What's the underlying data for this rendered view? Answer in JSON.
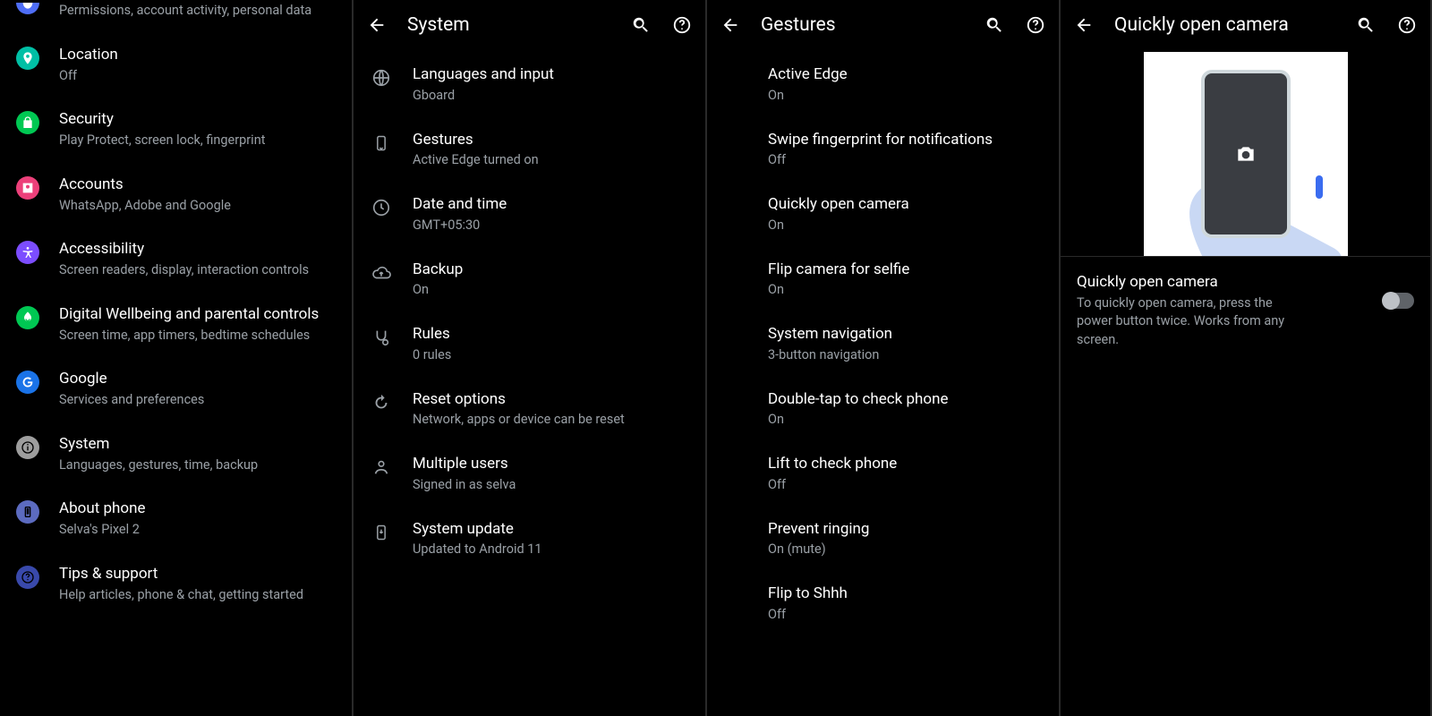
{
  "settings": {
    "privacy_sub": "Permissions, account activity, personal data",
    "items": [
      {
        "name": "Location",
        "sub": "Off"
      },
      {
        "name": "Security",
        "sub": "Play Protect, screen lock, fingerprint"
      },
      {
        "name": "Accounts",
        "sub": "WhatsApp, Adobe and Google"
      },
      {
        "name": "Accessibility",
        "sub": "Screen readers, display, interaction controls"
      },
      {
        "name": "Digital Wellbeing and parental controls",
        "sub": "Screen time, app timers, bedtime schedules"
      },
      {
        "name": "Google",
        "sub": "Services and preferences"
      },
      {
        "name": "System",
        "sub": "Languages, gestures, time, backup"
      },
      {
        "name": "About phone",
        "sub": "Selva's Pixel 2"
      },
      {
        "name": "Tips & support",
        "sub": "Help articles, phone & chat, getting started"
      }
    ]
  },
  "system": {
    "title": "System",
    "items": [
      {
        "name": "Languages and input",
        "sub": "Gboard"
      },
      {
        "name": "Gestures",
        "sub": "Active Edge turned on"
      },
      {
        "name": "Date and time",
        "sub": "GMT+05:30"
      },
      {
        "name": "Backup",
        "sub": "On"
      },
      {
        "name": "Rules",
        "sub": "0 rules"
      },
      {
        "name": "Reset options",
        "sub": "Network, apps or device can be reset"
      },
      {
        "name": "Multiple users",
        "sub": "Signed in as selva"
      },
      {
        "name": "System update",
        "sub": "Updated to Android 11"
      }
    ]
  },
  "gestures": {
    "title": "Gestures",
    "items": [
      {
        "name": "Active Edge",
        "sub": "On"
      },
      {
        "name": "Swipe fingerprint for notifications",
        "sub": "Off"
      },
      {
        "name": "Quickly open camera",
        "sub": "On"
      },
      {
        "name": "Flip camera for selfie",
        "sub": "On"
      },
      {
        "name": "System navigation",
        "sub": "3-button navigation"
      },
      {
        "name": "Double-tap to check phone",
        "sub": "On"
      },
      {
        "name": "Lift to check phone",
        "sub": "Off"
      },
      {
        "name": "Prevent ringing",
        "sub": "On (mute)"
      },
      {
        "name": "Flip to Shhh",
        "sub": "Off"
      }
    ]
  },
  "quickcam": {
    "title": "Quickly open camera",
    "toggle_title": "Quickly open camera",
    "toggle_desc": "To quickly open camera, press the power button twice. Works from any screen."
  }
}
